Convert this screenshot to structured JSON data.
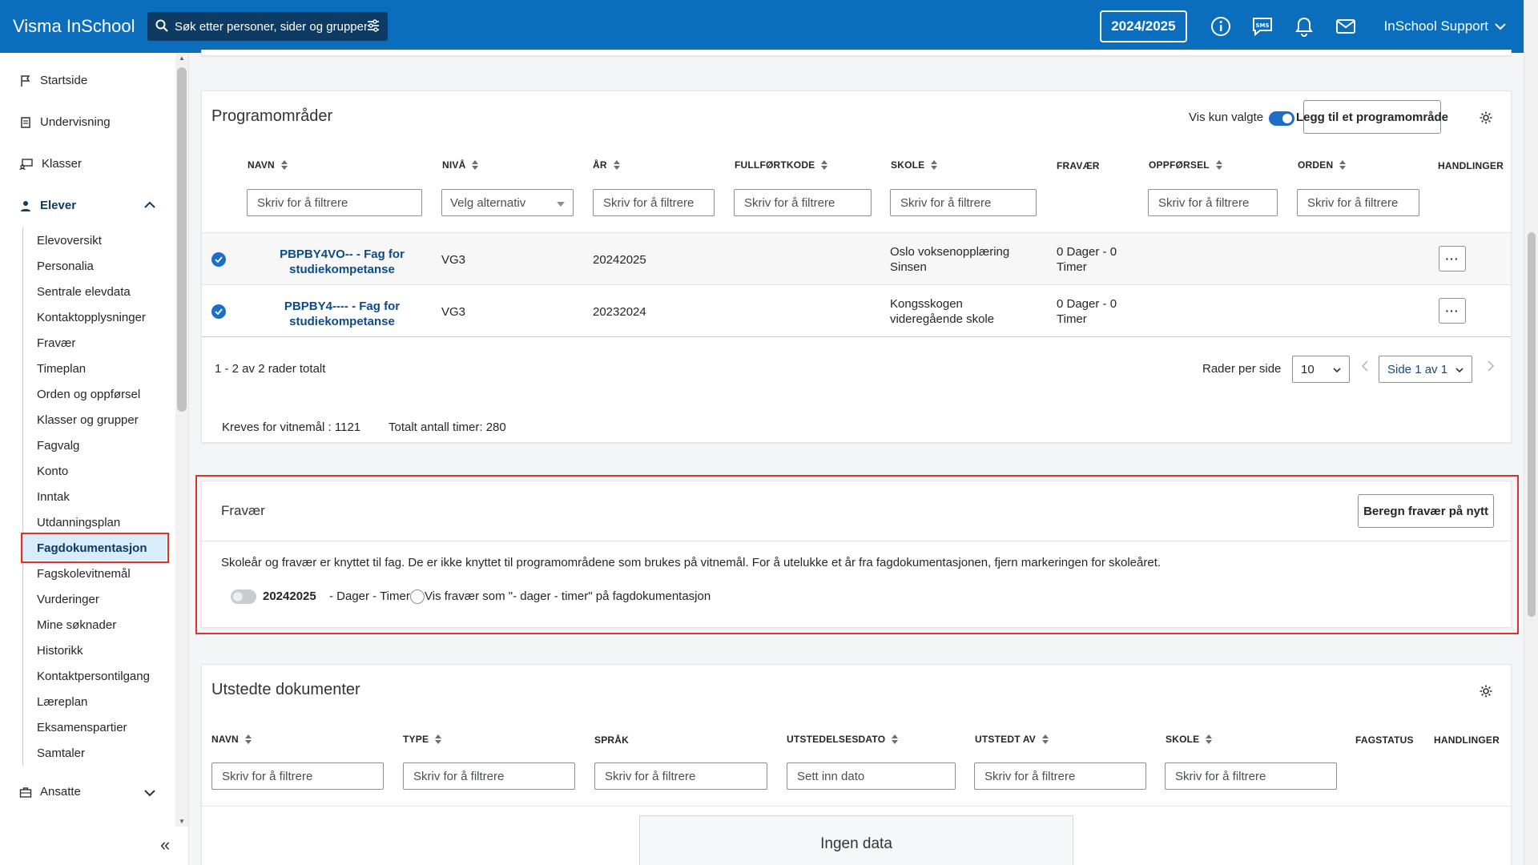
{
  "app": {
    "title": "Visma InSchool",
    "search_placeholder": "Søk etter personer, sider og grupper",
    "school_year": "2024/2025",
    "user": "InSchool Support"
  },
  "sidebar": {
    "top_items": [
      {
        "label": "Startside",
        "icon": "flag-icon"
      },
      {
        "label": "Undervisning",
        "icon": "book-icon"
      },
      {
        "label": "Klasser",
        "icon": "classroom-icon"
      },
      {
        "label": "Elever",
        "icon": "student-icon"
      },
      {
        "label": "Ansatte",
        "icon": "briefcase-icon"
      }
    ],
    "elever_items": [
      "Elevoversikt",
      "Personalia",
      "Sentrale elevdata",
      "Kontaktopplysninger",
      "Fravær",
      "Timeplan",
      "Orden og oppførsel",
      "Klasser og grupper",
      "Fagvalg",
      "Konto",
      "Inntak",
      "Utdanningsplan",
      "Fagdokumentasjon",
      "Fagskolevitnemål",
      "Vurderinger",
      "Mine søknader",
      "Historikk",
      "Kontaktpersontilgang",
      "Læreplan",
      "Eksamenspartier",
      "Samtaler"
    ],
    "active_item": "Fagdokumentasjon"
  },
  "programomrader": {
    "title": "Programområder",
    "vis_kun_valgte": "Vis kun valgte",
    "add_button": "Legg til et programområde",
    "columns": [
      "NAVN",
      "NIVÅ",
      "ÅR",
      "FULLFØRTKODE",
      "SKOLE",
      "FRAVÆR",
      "OPPFØRSEL",
      "ORDEN",
      "HANDLINGER"
    ],
    "filter_placeholder": "Skriv for å filtrere",
    "select_placeholder": "Velg alternativ",
    "rows": [
      {
        "name_line1": "PBPBY4VO-- - Fag for",
        "name_line2": "studiekompetanse",
        "niva": "VG3",
        "ar": "20242025",
        "skole_line1": "Oslo voksenopplæring",
        "skole_line2": "Sinsen",
        "fravaer_line1": "0 Dager - 0",
        "fravaer_line2": "Timer"
      },
      {
        "name_line1": "PBPBY4---- - Fag for",
        "name_line2": "studiekompetanse",
        "niva": "VG3",
        "ar": "20232024",
        "skole_line1": "Kongsskogen",
        "skole_line2": "videregående skole",
        "fravaer_line1": "0 Dager - 0",
        "fravaer_line2": "Timer"
      }
    ],
    "row_count": "1 - 2 av 2 rader totalt",
    "rows_per_page_label": "Rader per side",
    "rows_per_page": "10",
    "page": "Side 1 av 1",
    "kreves": "Kreves for vitnemål : 1121",
    "totalt": "Totalt antall timer: 280"
  },
  "fravaer": {
    "title": "Fravær",
    "recalc_button": "Beregn fravær på nytt",
    "description": "Skoleår og fravær er knyttet til fag. De er ikke knyttet til programområdene som brukes på vitnemål. For å utelukke et år fra fagdokumentasjonen, fjern markeringen for skoleåret.",
    "year": "20242025",
    "year_suffix": "- Dager - Timer",
    "checkbox_label": "Vis fravær som \"- dager - timer\" på fagdokumentasjon"
  },
  "utstedte": {
    "title": "Utstedte dokumenter",
    "columns": [
      "NAVN",
      "TYPE",
      "SPRÅK",
      "UTSTEDELSESDATO",
      "UTSTEDT AV",
      "SKOLE",
      "FAGSTATUS",
      "HANDLINGER"
    ],
    "filter_placeholder": "Skriv for å filtrere",
    "date_placeholder": "Sett inn dato",
    "empty": "Ingen data"
  },
  "colors": {
    "topbar": "#0a6ebd",
    "accent": "#1c6ec6",
    "highlight": "#d9342b"
  }
}
